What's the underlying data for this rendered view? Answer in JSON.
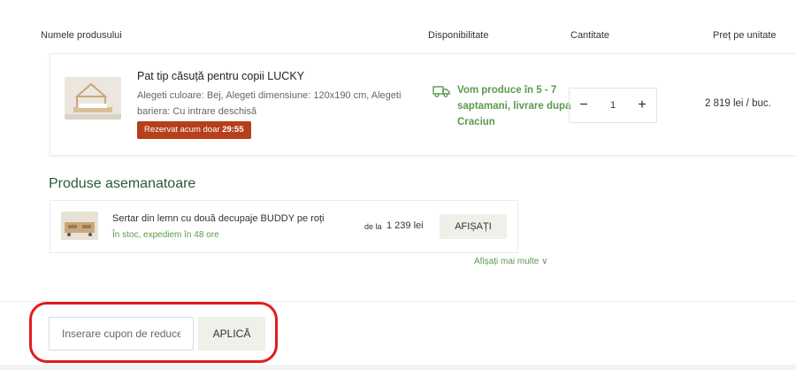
{
  "columns": {
    "product": "Numele produsului",
    "availability": "Disponibilitate",
    "quantity": "Cantitate",
    "unit_price": "Preț pe unitate"
  },
  "cart_item": {
    "name": "Pat tip căsuță pentru copii LUCKY",
    "description": "Alegeti culoare: Bej, Alegeti dimensiune: 120x190 cm, Alegeti bariera: Cu intrare deschisă",
    "badge_prefix": "Rezervat acum doar",
    "badge_timer": "29:55",
    "availability": "Vom produce în 5 - 7 saptamani, livrare dupa Craciun",
    "quantity": "1",
    "minus": "−",
    "plus": "+",
    "price": "2 819 lei / buc.",
    "availability_color": "#5b9a4b",
    "badge_color": "#b63f1c",
    "icons": [
      "truck-icon",
      "bed-thumbnail"
    ]
  },
  "similar": {
    "title": "Produse asemanatoare",
    "items": [
      {
        "name": "Sertar din lemn cu două decupaje BUDDY pe roți",
        "stock": "În stoc, expediem în 48 ore",
        "from_label": "de la",
        "price": "1 239 lei",
        "button": "AFIȘAȚI"
      }
    ],
    "show_more": "Afișați mai multe ∨"
  },
  "coupon": {
    "placeholder": "Inserare cupon de reducere",
    "apply": "APLICĂ"
  },
  "colors": {
    "accent_green": "#5b9a4b",
    "heading_green": "#2a5a3a",
    "annotation_red": "#e11d1d",
    "button_bg": "#eef0ea"
  }
}
